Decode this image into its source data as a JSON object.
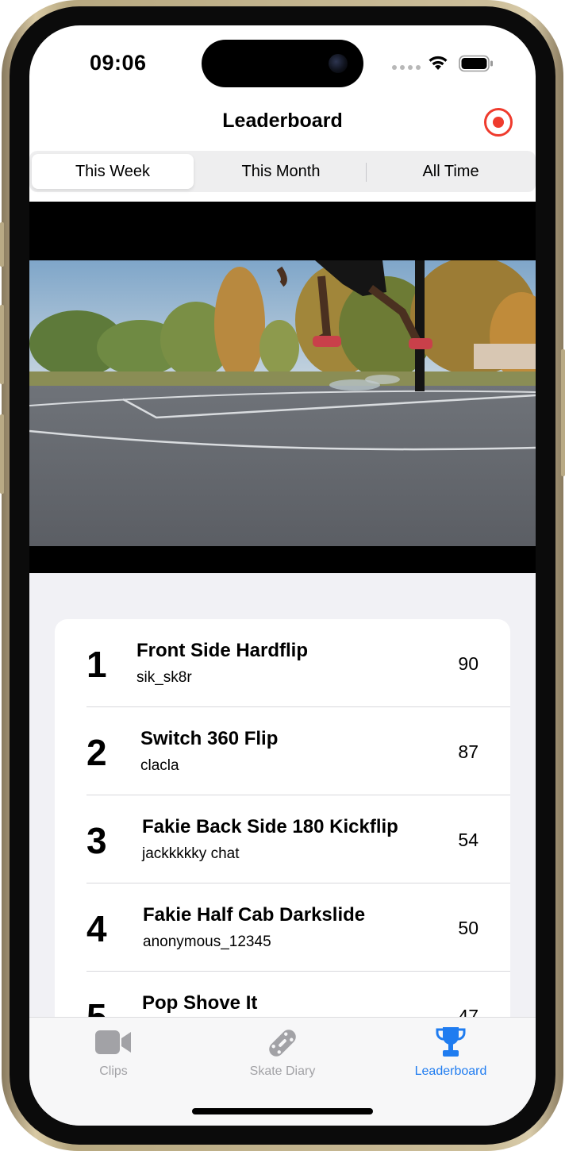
{
  "status_bar": {
    "time": "09:06",
    "icons": [
      "cellular-dots-icon",
      "wifi-icon",
      "battery-icon"
    ]
  },
  "nav": {
    "title": "Leaderboard",
    "record_icon": "record-icon"
  },
  "segments": [
    {
      "label": "This Week",
      "selected": true
    },
    {
      "label": "This Month",
      "selected": false
    },
    {
      "label": "All Time",
      "selected": false
    }
  ],
  "leaderboard": [
    {
      "rank": "1",
      "trick": "Front Side Hardflip",
      "user": "sik_sk8r",
      "score": "90"
    },
    {
      "rank": "2",
      "trick": "Switch 360 Flip",
      "user": "clacla",
      "score": "87"
    },
    {
      "rank": "3",
      "trick": "Fakie Back Side 180 Kickflip",
      "user": "jackkkkky chat",
      "score": "54"
    },
    {
      "rank": "4",
      "trick": "Fakie Half Cab Darkslide",
      "user": "anonymous_12345",
      "score": "50"
    },
    {
      "rank": "5",
      "trick": "Pop Shove It",
      "user": "",
      "score": "47"
    }
  ],
  "tabs": [
    {
      "label": "Clips",
      "icon": "video-camera-icon",
      "active": false
    },
    {
      "label": "Skate Diary",
      "icon": "skateboard-icon",
      "active": false
    },
    {
      "label": "Leaderboard",
      "icon": "trophy-icon",
      "active": true
    }
  ],
  "colors": {
    "accent": "#1f7cf0",
    "record": "#ef3b2d",
    "inactive_tab": "#a2a2a6",
    "list_background": "#f1f1f5"
  }
}
